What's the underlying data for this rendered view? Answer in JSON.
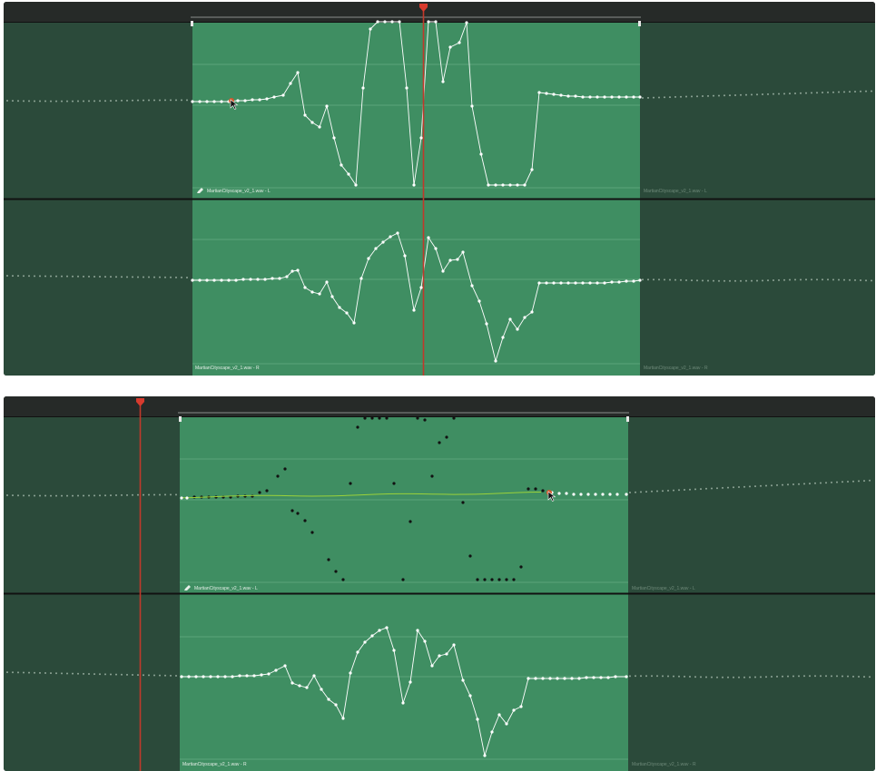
{
  "panel_top": {
    "upper_lane_label": "MartianCityscape_v2_1.wav - L",
    "lower_lane_label": "MartianCityscape_v2_1.wav - R",
    "upper_lane_label_right": "MartianCityscape_v2_1.wav - L",
    "lower_lane_label_right": "MartianCityscape_v2_1.wav - R"
  },
  "panel_bottom": {
    "upper_lane_label": "MartianCityscape_v2_1.wav - L",
    "lower_lane_label": "MartianCityscape_v2_1.wav - R",
    "upper_lane_label_right": "MartianCityscape_v2_1.wav - L",
    "lower_lane_label_right": "MartianCityscape_v2_1.wav - R"
  },
  "colors": {
    "playhead": "#c0392b",
    "clip": "#3f8e62",
    "track": "#2b4a3a",
    "curve_active": "#ffffff",
    "curve_inactive": "#8fa597",
    "curve_edit": "#9bd23a",
    "original_points": "#111111"
  },
  "icons": {
    "pencil": "pencil-icon",
    "playhead_head": "playhead-marker-icon",
    "cursor": "mouse-pointer-icon"
  }
}
